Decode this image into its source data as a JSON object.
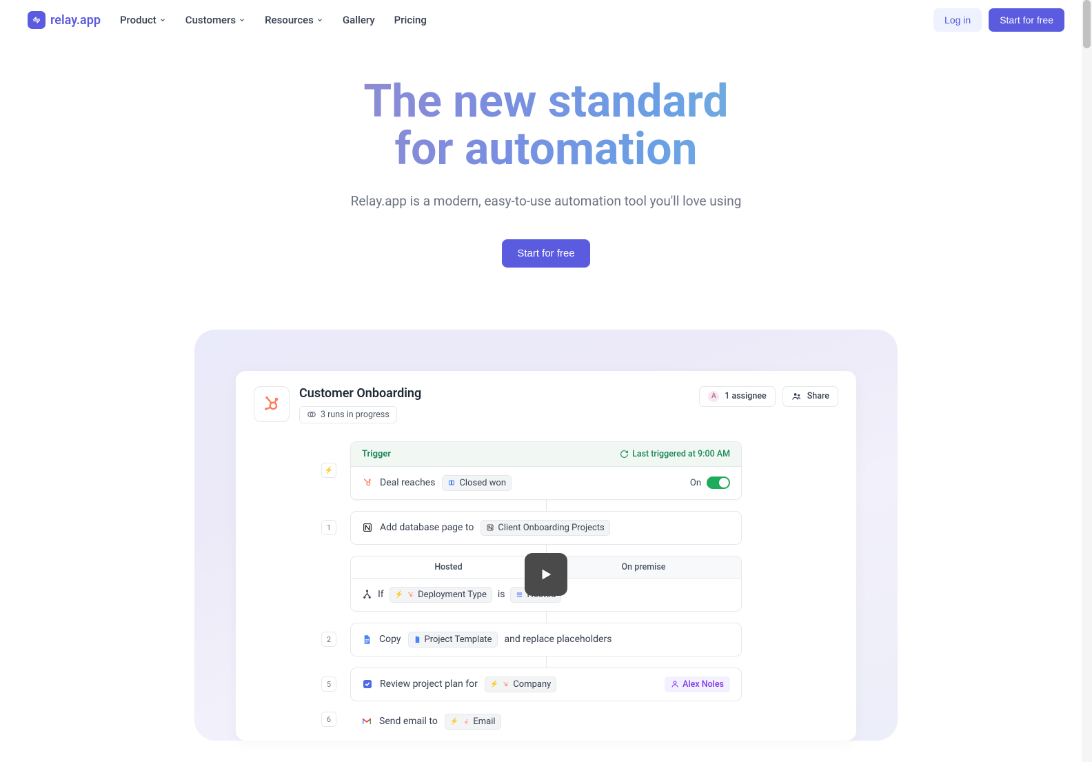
{
  "brand": {
    "name": "relay.app"
  },
  "nav": {
    "items": [
      {
        "label": "Product",
        "dropdown": true
      },
      {
        "label": "Customers",
        "dropdown": true
      },
      {
        "label": "Resources",
        "dropdown": true
      },
      {
        "label": "Gallery",
        "dropdown": false
      },
      {
        "label": "Pricing",
        "dropdown": false
      }
    ],
    "login": "Log in",
    "cta": "Start for free"
  },
  "hero": {
    "title_line1": "The new standard",
    "title_line2": "for automation",
    "subtitle": "Relay.app is a modern, easy-to-use automation tool you'll love using",
    "cta": "Start for free"
  },
  "workflow": {
    "title": "Customer Onboarding",
    "runs_label": "3 runs in progress",
    "assignee_letter": "A",
    "assignee_label": "1 assignee",
    "share_label": "Share",
    "trigger": {
      "header": "Trigger",
      "last": "Last triggered at 9:00 AM",
      "text": "Deal reaches",
      "chip": "Closed won",
      "on_label": "On"
    },
    "step1": {
      "num": "1",
      "text_before": "Add database page to",
      "chip": "Client Onboarding Projects"
    },
    "paths": {
      "tab1": "Hosted",
      "tab2": "On premise",
      "if_label": "If",
      "field": "Deployment Type",
      "is_label": "is",
      "value": "Hosted"
    },
    "step2": {
      "num": "2",
      "action": "Copy",
      "chip": "Project Template",
      "suffix": "and replace placeholders"
    },
    "step5": {
      "num": "5",
      "text": "Review project plan for",
      "chip": "Company",
      "assignee": "Alex Noles"
    },
    "step6": {
      "num": "6",
      "text": "Send email to",
      "chip": "Email"
    }
  },
  "step_bolt_marker": "⚡"
}
